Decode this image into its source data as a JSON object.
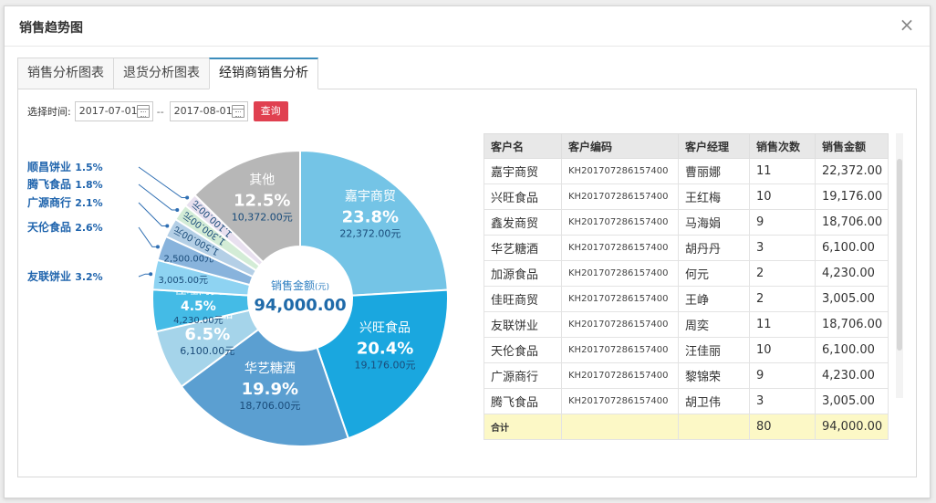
{
  "dialog": {
    "title": "销售趋势图",
    "close_icon": "×"
  },
  "tabs": [
    {
      "label": "销售分析图表",
      "active": false
    },
    {
      "label": "退货分析图表",
      "active": false
    },
    {
      "label": "经销商销售分析",
      "active": true
    }
  ],
  "filter": {
    "label": "选择时间:",
    "start_date": "2017-07-01",
    "separator": "--",
    "end_date": "2017-08-01",
    "query_label": "查询"
  },
  "chart_data": {
    "type": "pie",
    "center_label": "销售金额",
    "center_unit": "(元)",
    "center_total": "94,000.00",
    "slices": [
      {
        "name": "嘉宇商贸",
        "percent": "23.8%",
        "amount": "22,372.00元",
        "value": 22372,
        "color": "#74c4e6"
      },
      {
        "name": "兴旺食品",
        "percent": "20.4%",
        "amount": "19,176.00元",
        "value": 19176,
        "color": "#1aa7df"
      },
      {
        "name": "华艺糖酒",
        "percent": "19.9%",
        "amount": "18,706.00元",
        "value": 18706,
        "color": "#5b9fd1"
      },
      {
        "name": "加源食品",
        "percent": "6.5%",
        "amount": "6,100.00元",
        "value": 6100,
        "color": "#a5d4ea"
      },
      {
        "name": "佳旺商贸",
        "percent": "4.5%",
        "amount": "4,230.00元",
        "value": 4230,
        "color": "#44bbe6"
      },
      {
        "name": "友联饼业",
        "percent": "3.2%",
        "amount": "3,005.00元",
        "value": 3005,
        "color": "#8ed3f2"
      },
      {
        "name": "天伦食品",
        "percent": "2.6%",
        "amount": "2,500.00元",
        "value": 2500,
        "color": "#88b3dc"
      },
      {
        "name": "广源商行",
        "percent": "2.1%",
        "amount": "1,500.00元",
        "value": 1980,
        "color": "#b4cfe6"
      },
      {
        "name": "腾飞食品",
        "percent": "1.8%",
        "amount": "1,300.00元",
        "value": 1690,
        "color": "#d3ecd6"
      },
      {
        "name": "顺昌饼业",
        "percent": "1.5%",
        "amount": "1,100.00元",
        "value": 1410,
        "color": "#e8e0ef"
      },
      {
        "name": "其他",
        "percent": "12.5%",
        "amount": "10,372.00元",
        "value": 11750,
        "color": "#b7b7b7"
      }
    ]
  },
  "table": {
    "headers": [
      "客户名",
      "客户编码",
      "客户经理",
      "销售次数",
      "销售金额"
    ],
    "rows": [
      [
        "嘉宇商贸",
        "KH201707286157400",
        "曹丽娜",
        "11",
        "22,372.00"
      ],
      [
        "兴旺食品",
        "KH201707286157400",
        "王红梅",
        "10",
        "19,176.00"
      ],
      [
        "鑫发商贸",
        "KH201707286157400",
        "马海娟",
        "9",
        "18,706.00"
      ],
      [
        "华艺糖酒",
        "KH201707286157400",
        "胡丹丹",
        "3",
        "6,100.00"
      ],
      [
        "加源食品",
        "KH201707286157400",
        "何元",
        "2",
        "4,230.00"
      ],
      [
        "佳旺商贸",
        "KH201707286157400",
        "王峥",
        "2",
        "3,005.00"
      ],
      [
        "友联饼业",
        "KH201707286157400",
        "周奕",
        "11",
        "18,706.00"
      ],
      [
        "天伦食品",
        "KH201707286157400",
        "汪佳丽",
        "10",
        "6,100.00"
      ],
      [
        "广源商行",
        "KH201707286157400",
        "黎锦荣",
        "9",
        "4,230.00"
      ],
      [
        "腾飞食品",
        "KH201707286157400",
        "胡卫伟",
        "3",
        "3,005.00"
      ]
    ],
    "total": {
      "label": "合计",
      "count": "80",
      "amount": "94,000.00"
    }
  }
}
